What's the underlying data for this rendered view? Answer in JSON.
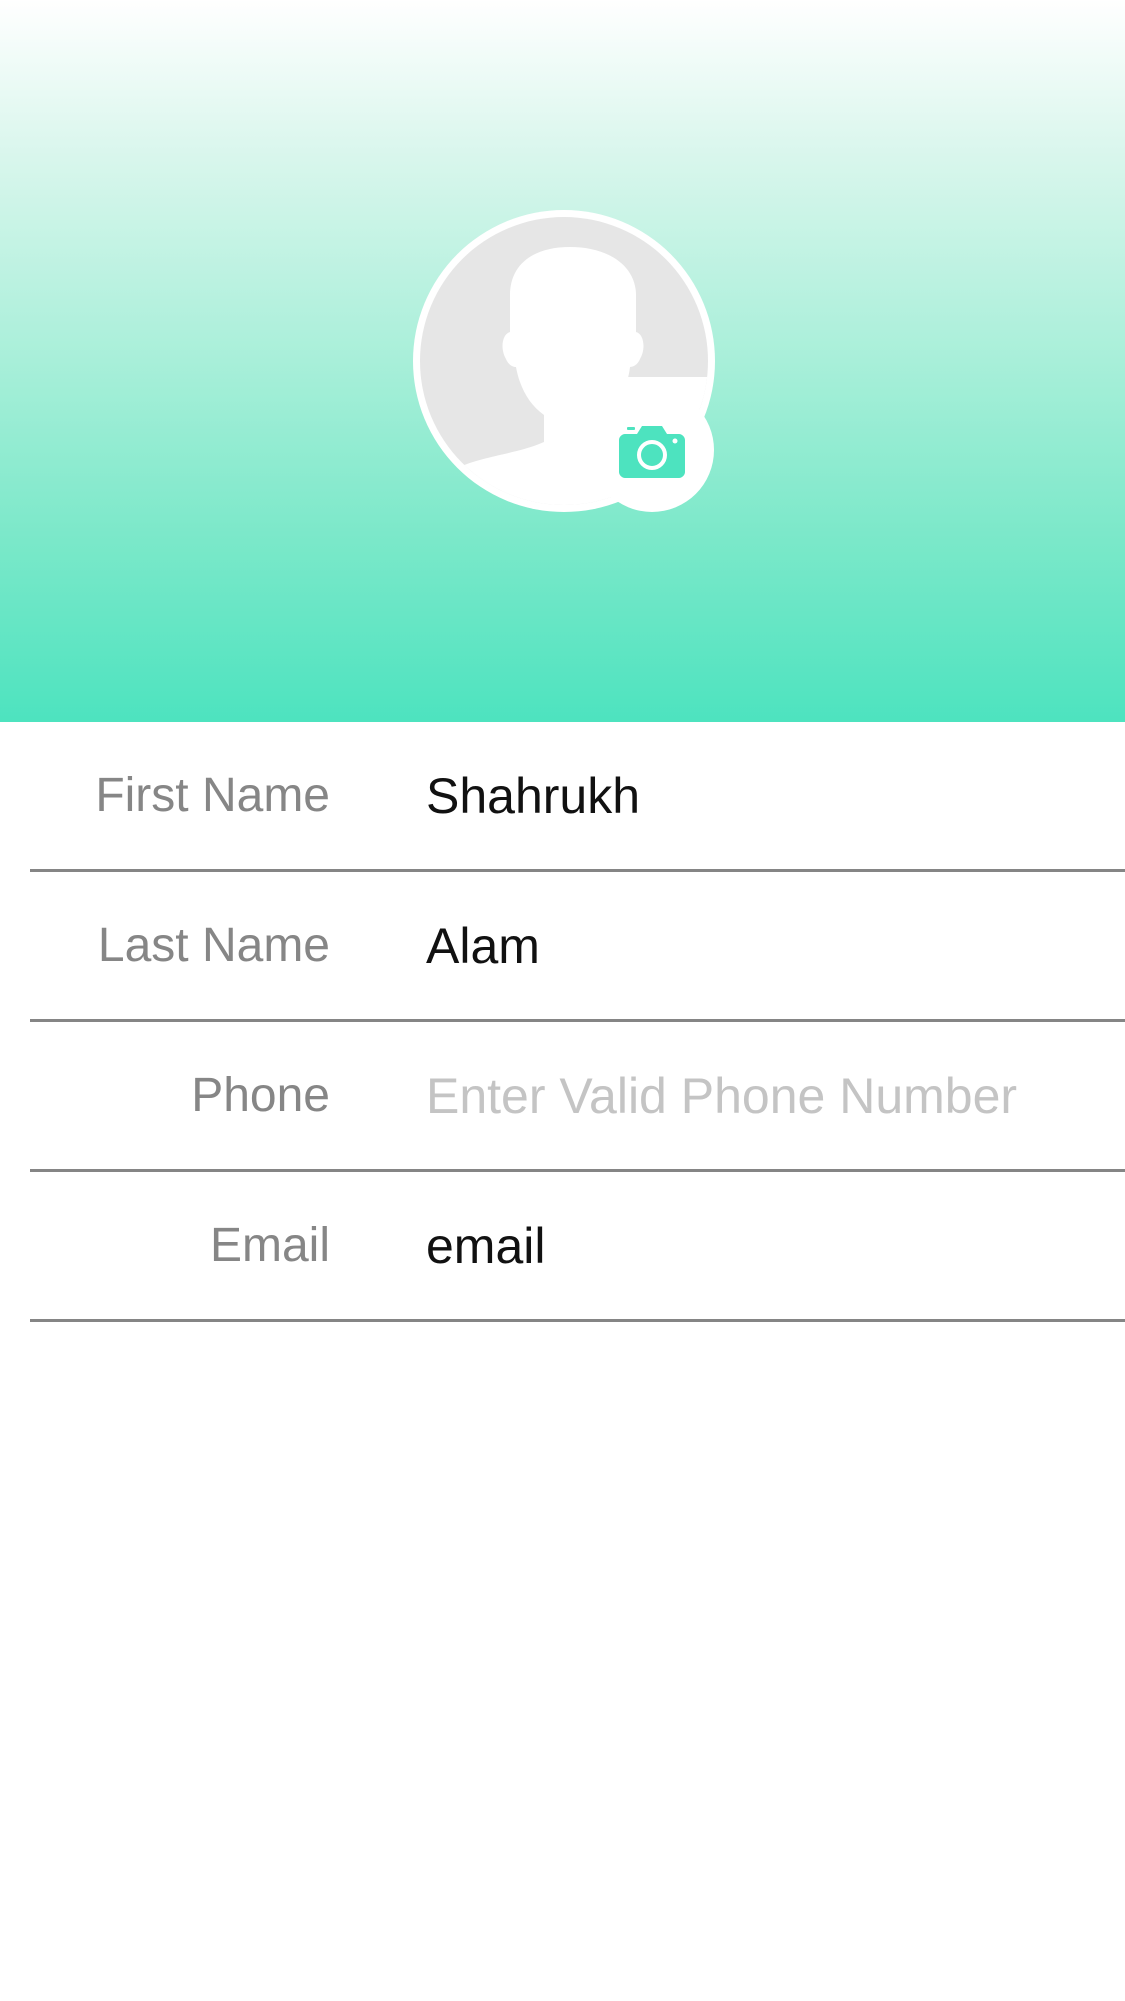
{
  "colors": {
    "accent": "#4de3bf",
    "label": "#868686",
    "value": "#111111",
    "placeholder": "#c4c4c4",
    "divider": "#858585",
    "avatar_bg": "#e6e6e6"
  },
  "header": {
    "avatar_icon": "person-silhouette-icon",
    "camera_icon": "camera-icon"
  },
  "form": {
    "first_name": {
      "label": "First Name",
      "value": "Shahrukh",
      "placeholder": ""
    },
    "last_name": {
      "label": "Last Name",
      "value": "Alam",
      "placeholder": ""
    },
    "phone": {
      "label": "Phone",
      "value": "",
      "placeholder": "Enter Valid Phone Number"
    },
    "email": {
      "label": "Email",
      "value": "email",
      "placeholder": ""
    }
  }
}
